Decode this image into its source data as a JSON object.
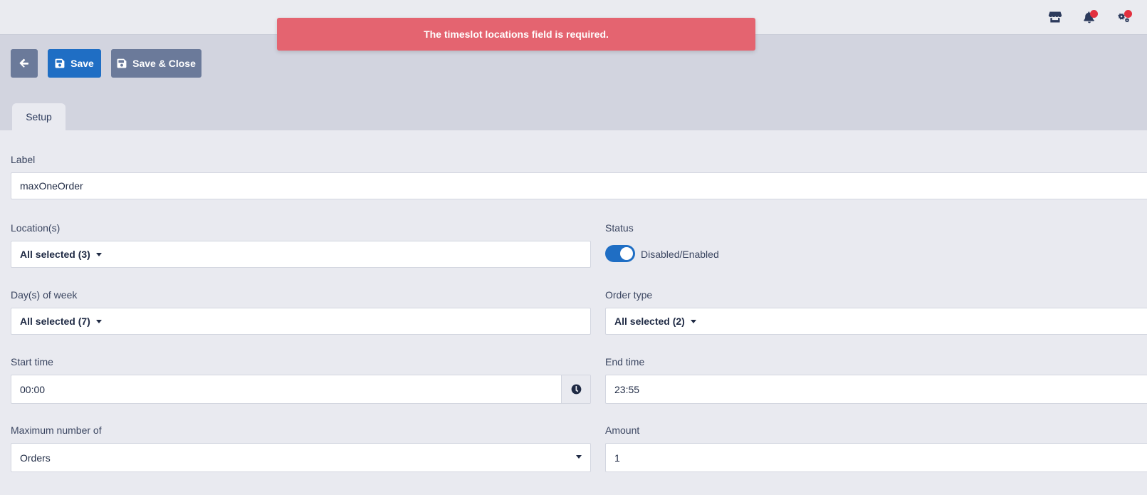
{
  "topbar": {
    "icons": [
      "store-icon",
      "bell-icon",
      "gears-icon"
    ],
    "notification_color": "#e2303f"
  },
  "alert": {
    "message": "The timeslot locations field is required."
  },
  "toolbar": {
    "save_label": "Save",
    "save_close_label": "Save & Close"
  },
  "tabs": [
    {
      "label": "Setup"
    }
  ],
  "form": {
    "label": {
      "title": "Label",
      "value": "maxOneOrder"
    },
    "locations": {
      "title": "Location(s)",
      "value": "All selected (3)"
    },
    "status": {
      "title": "Status",
      "toggle_label": "Disabled/Enabled",
      "enabled": true
    },
    "days": {
      "title": "Day(s) of week",
      "value": "All selected (7)"
    },
    "order_type": {
      "title": "Order type",
      "value": "All selected (2)"
    },
    "start_time": {
      "title": "Start time",
      "value": "00:00"
    },
    "end_time": {
      "title": "End time",
      "value": "23:55"
    },
    "max_number": {
      "title": "Maximum number of",
      "value": "Orders"
    },
    "amount": {
      "title": "Amount",
      "value": "1"
    }
  },
  "colors": {
    "primary": "#1f6ec4",
    "secondary": "#6b7a9a",
    "alert": "#e46470"
  }
}
